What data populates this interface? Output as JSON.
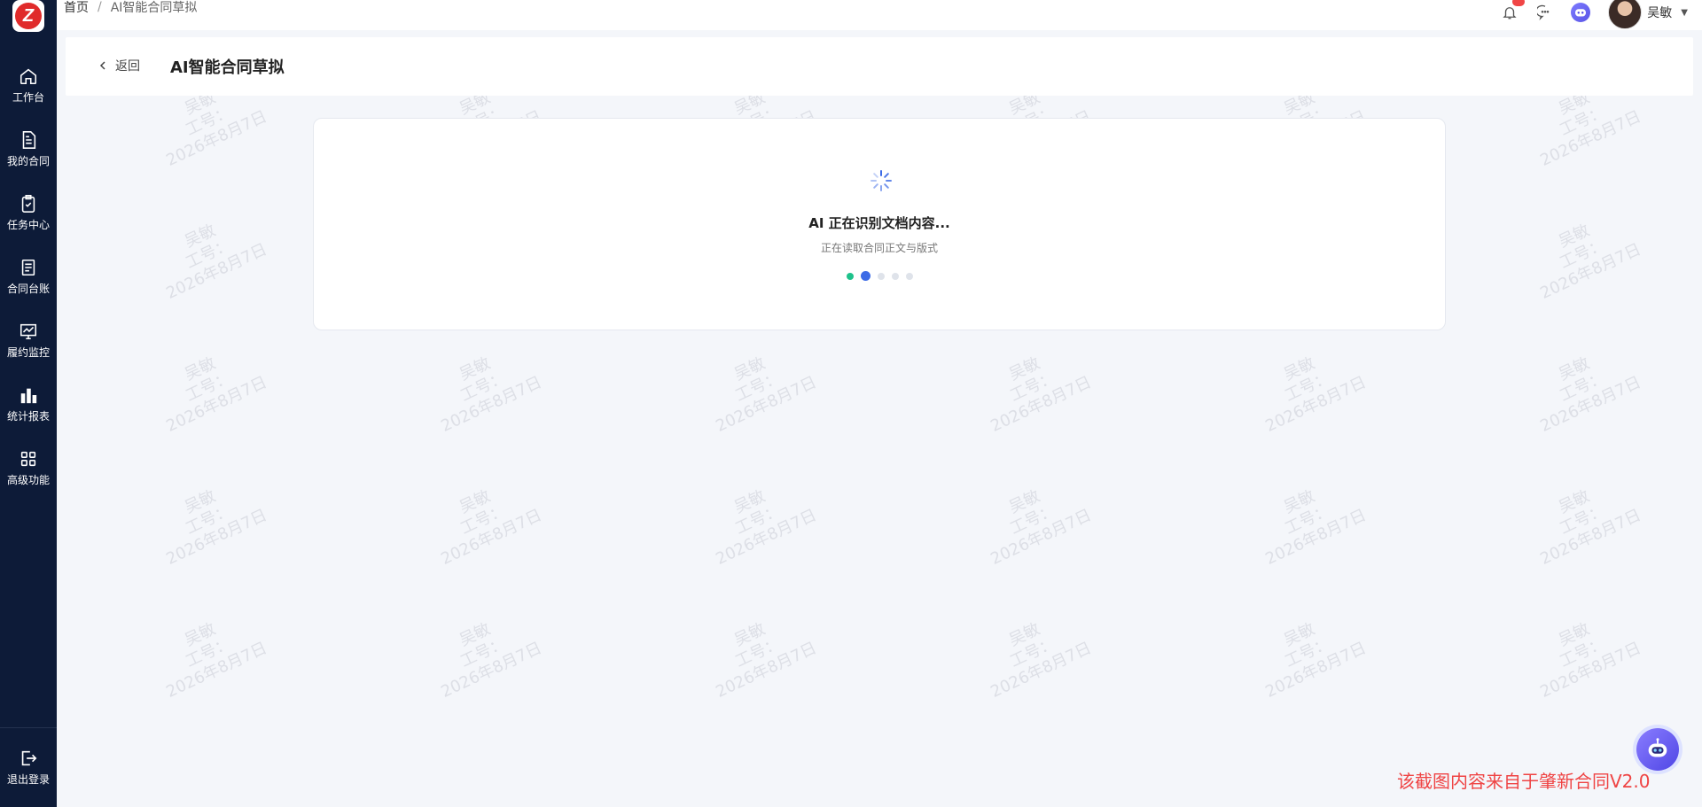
{
  "sidebar": {
    "logo_letter": "Z",
    "items": [
      {
        "label": "工作台",
        "icon": "home-icon"
      },
      {
        "label": "我的合同",
        "icon": "document-icon"
      },
      {
        "label": "任务中心",
        "icon": "clipboard-check-icon"
      },
      {
        "label": "合同台账",
        "icon": "ledger-icon"
      },
      {
        "label": "履约监控",
        "icon": "monitor-chart-icon"
      },
      {
        "label": "统计报表",
        "icon": "bar-chart-icon"
      },
      {
        "label": "高级功能",
        "icon": "grid-icon"
      }
    ],
    "logout": {
      "label": "退出登录",
      "icon": "logout-icon"
    }
  },
  "topbar": {
    "breadcrumb": {
      "home": "首页",
      "separator": "/",
      "current": "AI智能合同草拟"
    },
    "user_name": "吴敏",
    "icons": [
      "bell-icon",
      "chat-icon",
      "robot-icon",
      "caret-down-icon"
    ]
  },
  "page": {
    "back_label": "返回",
    "title": "AI智能合同草拟"
  },
  "loading": {
    "title": "AI 正在识别文档内容...",
    "subtitle": "正在读取合同正文与版式",
    "steps_total": 5,
    "step_done": 1,
    "step_active": 2
  },
  "watermark": {
    "line1": "吴敏",
    "line2": "工号：",
    "line3": "2026年8月7日"
  },
  "source_note": "该截图内容来自于肇新合同V2.0",
  "colors": {
    "sidebar_bg": "#0d1b38",
    "accent_blue": "#3d6be6",
    "done_green": "#1ec28b",
    "note_red": "#ef4444"
  }
}
